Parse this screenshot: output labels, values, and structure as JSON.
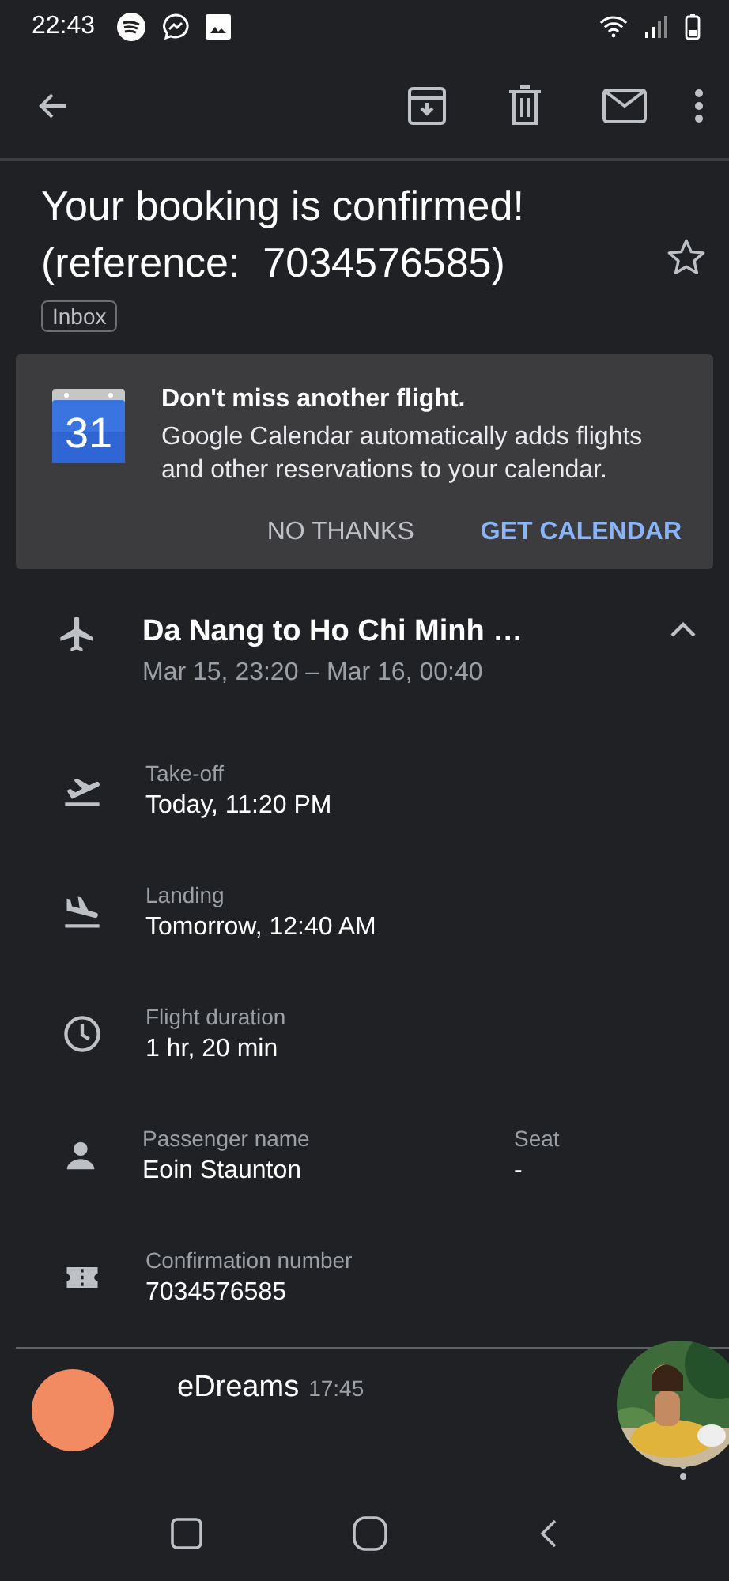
{
  "status_bar": {
    "time": "22:43"
  },
  "subject": {
    "text": "Your booking is confirmed! (reference:  7034576585)",
    "starred": false
  },
  "label": "Inbox",
  "promo": {
    "title": "Don't miss another flight.",
    "body": "Google Calendar automatically adds flights and other reservations to your calendar.",
    "calendar_day": "31",
    "dismiss": "NO THANKS",
    "action": "GET CALENDAR"
  },
  "flight": {
    "title": "Da Nang to Ho Chi Minh …",
    "times": "Mar 15, 23:20 – Mar 16, 00:40",
    "expanded": true
  },
  "details": [
    {
      "kind": "takeoff",
      "label": "Take-off",
      "value": "Today, 11:20 PM"
    },
    {
      "kind": "landing",
      "label": "Landing",
      "value": "Tomorrow, 12:40 AM"
    },
    {
      "kind": "duration",
      "label": "Flight duration",
      "value": "1 hr, 20 min"
    },
    {
      "kind": "passenger",
      "label": "Passenger name",
      "value": "Eoin Staunton",
      "extra": {
        "label": "Seat",
        "value": "-"
      }
    },
    {
      "kind": "confirmation",
      "label": "Confirmation number",
      "value": "7034576585"
    }
  ],
  "next_message": {
    "sender": "eDreams",
    "time": "17:45"
  }
}
